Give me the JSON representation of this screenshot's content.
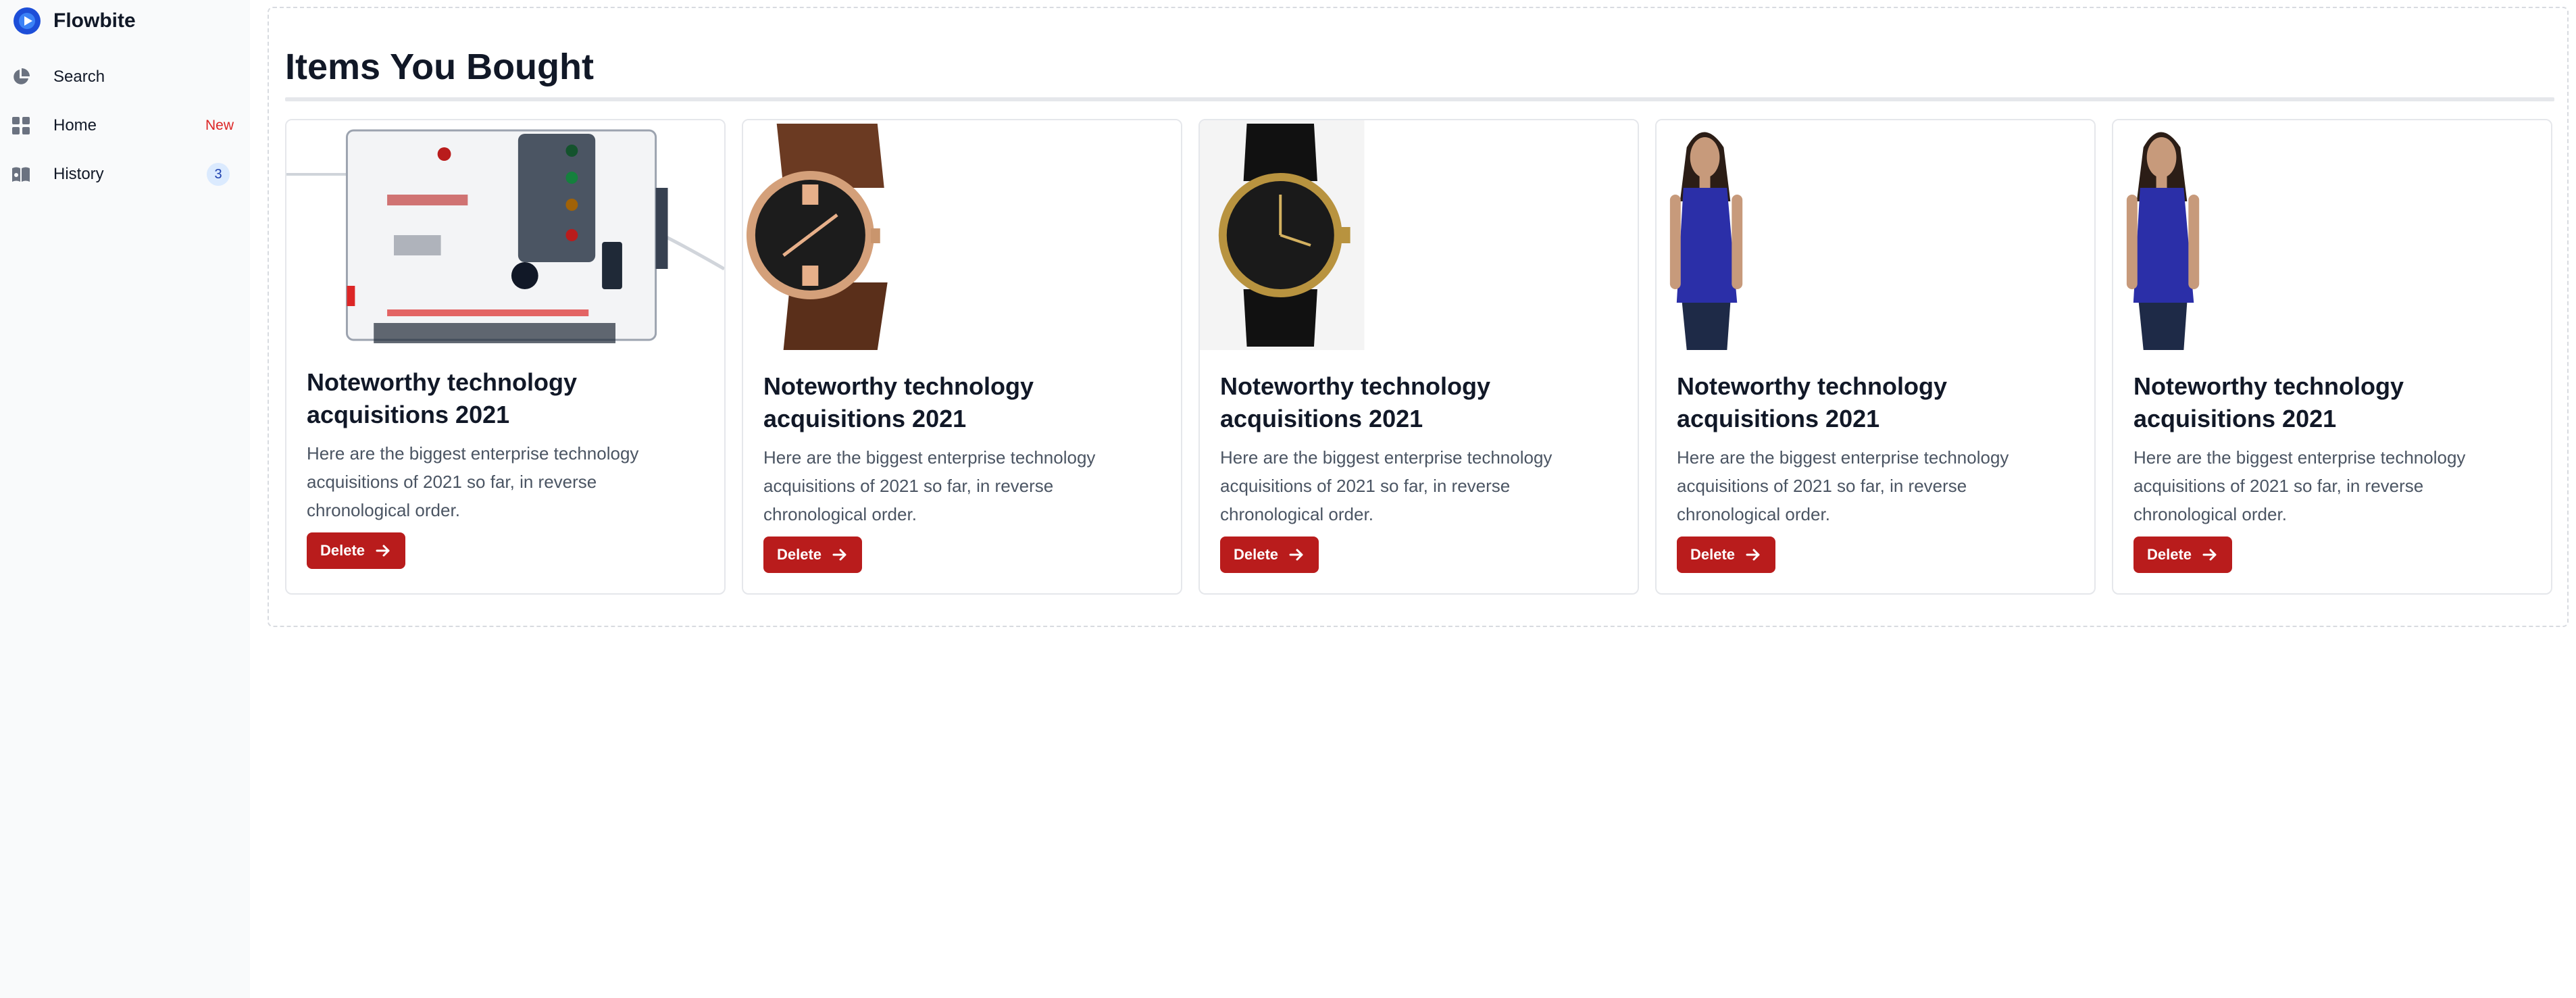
{
  "sidebar": {
    "brand": "Flowbite",
    "items": [
      {
        "label": "Search",
        "icon": "chart-pie-icon"
      },
      {
        "label": "Home",
        "icon": "grid-icon",
        "badge": "New"
      },
      {
        "label": "History",
        "icon": "book-icon",
        "badge": "3"
      }
    ]
  },
  "main": {
    "title": "Items You Bought",
    "cards": [
      {
        "image": "water-pump-controller",
        "title": "Noteworthy technology acquisitions 2021",
        "text": "Here are the biggest enterprise technology acquisitions of 2021 so far, in reverse chronological order.",
        "button": "Delete"
      },
      {
        "image": "brown-wristwatch",
        "title": "Noteworthy technology acquisitions 2021",
        "text": "Here are the biggest enterprise technology acquisitions of 2021 so far, in reverse chronological order.",
        "button": "Delete"
      },
      {
        "image": "black-wristwatch",
        "title": "Noteworthy technology acquisitions 2021",
        "text": "Here are the biggest enterprise technology acquisitions of 2021 so far, in reverse chronological order.",
        "button": "Delete"
      },
      {
        "image": "woman-blue-top",
        "title": "Noteworthy technology acquisitions 2021",
        "text": "Here are the biggest enterprise technology acquisitions of 2021 so far, in reverse chronological order.",
        "button": "Delete"
      },
      {
        "image": "woman-blue-top",
        "title": "Noteworthy technology acquisitions 2021",
        "text": "Here are the biggest enterprise technology acquisitions of 2021 so far, in reverse chronological order.",
        "button": "Delete"
      }
    ]
  },
  "colors": {
    "accent": "#b91c1c",
    "brand": "#1d4ed8",
    "badge_new": "#dc2626",
    "badge_count_bg": "#dbeafe"
  }
}
